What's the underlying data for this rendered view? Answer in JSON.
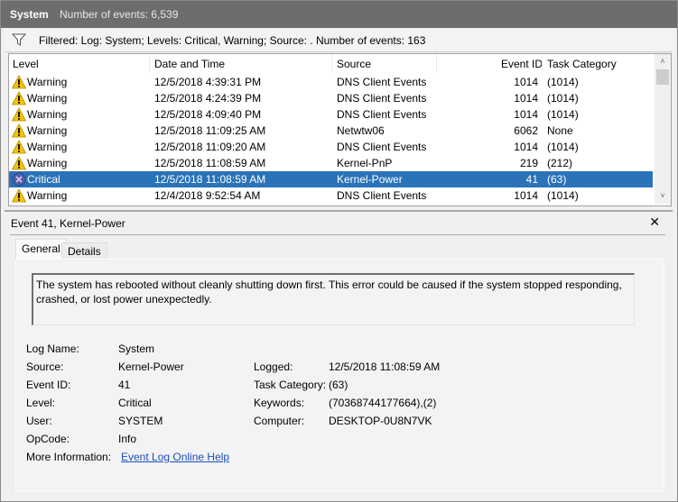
{
  "title": {
    "log_name": "System",
    "event_count": "Number of events: 6,539"
  },
  "filter": {
    "icon": "filter-icon",
    "text": "Filtered: Log: System; Levels: Critical, Warning; Source: . Number of events: 163"
  },
  "grid": {
    "columns": [
      "Level",
      "Date and Time",
      "Source",
      "Event ID",
      "Task Category"
    ],
    "rows": [
      {
        "level": "Warning",
        "icon": "warning-icon",
        "date": "12/5/2018 4:39:31 PM",
        "source": "DNS Client Events",
        "event_id": "1014",
        "task": "(1014)",
        "selected": false
      },
      {
        "level": "Warning",
        "icon": "warning-icon",
        "date": "12/5/2018 4:24:39 PM",
        "source": "DNS Client Events",
        "event_id": "1014",
        "task": "(1014)",
        "selected": false
      },
      {
        "level": "Warning",
        "icon": "warning-icon",
        "date": "12/5/2018 4:09:40 PM",
        "source": "DNS Client Events",
        "event_id": "1014",
        "task": "(1014)",
        "selected": false
      },
      {
        "level": "Warning",
        "icon": "warning-icon",
        "date": "12/5/2018 11:09:25 AM",
        "source": "Netwtw06",
        "event_id": "6062",
        "task": "None",
        "selected": false
      },
      {
        "level": "Warning",
        "icon": "warning-icon",
        "date": "12/5/2018 11:09:20 AM",
        "source": "DNS Client Events",
        "event_id": "1014",
        "task": "(1014)",
        "selected": false
      },
      {
        "level": "Warning",
        "icon": "warning-icon",
        "date": "12/5/2018 11:08:59 AM",
        "source": "Kernel-PnP",
        "event_id": "219",
        "task": "(212)",
        "selected": false
      },
      {
        "level": "Critical",
        "icon": "critical-icon",
        "date": "12/5/2018 11:08:59 AM",
        "source": "Kernel-Power",
        "event_id": "41",
        "task": "(63)",
        "selected": true
      },
      {
        "level": "Warning",
        "icon": "warning-icon",
        "date": "12/4/2018 9:52:54 AM",
        "source": "DNS Client Events",
        "event_id": "1014",
        "task": "(1014)",
        "selected": false
      }
    ],
    "scroll_up": "˄",
    "scroll_down": "˅"
  },
  "detail": {
    "title": "Event 41, Kernel-Power",
    "close": "✕",
    "tabs": [
      "General",
      "Details"
    ],
    "description": "The system has rebooted without cleanly shutting down first. This error could be caused if the system stopped responding, crashed, or lost power unexpectedly.",
    "fields_left": [
      {
        "label": "Log Name:",
        "value": "System"
      },
      {
        "label": "Source:",
        "value": "Kernel-Power"
      },
      {
        "label": "Event ID:",
        "value": "41"
      },
      {
        "label": "Level:",
        "value": "Critical"
      },
      {
        "label": "User:",
        "value": "SYSTEM"
      },
      {
        "label": "OpCode:",
        "value": "Info"
      },
      {
        "label": "More Information:",
        "value": "Event Log Online Help"
      }
    ],
    "fields_right": [
      {
        "label": "Logged:",
        "value": "12/5/2018 11:08:59 AM"
      },
      {
        "label": "Task Category:",
        "value": "(63)"
      },
      {
        "label": "Keywords:",
        "value": "(70368744177664),(2)"
      },
      {
        "label": "Computer:",
        "value": "DESKTOP-0U8N7VK"
      }
    ]
  },
  "colors": {
    "selection": "#2a73b8",
    "titlebar": "#6d6d6d",
    "link": "#1a4fb8",
    "warning": "#f5c400",
    "critical": "#4a5fa8"
  }
}
